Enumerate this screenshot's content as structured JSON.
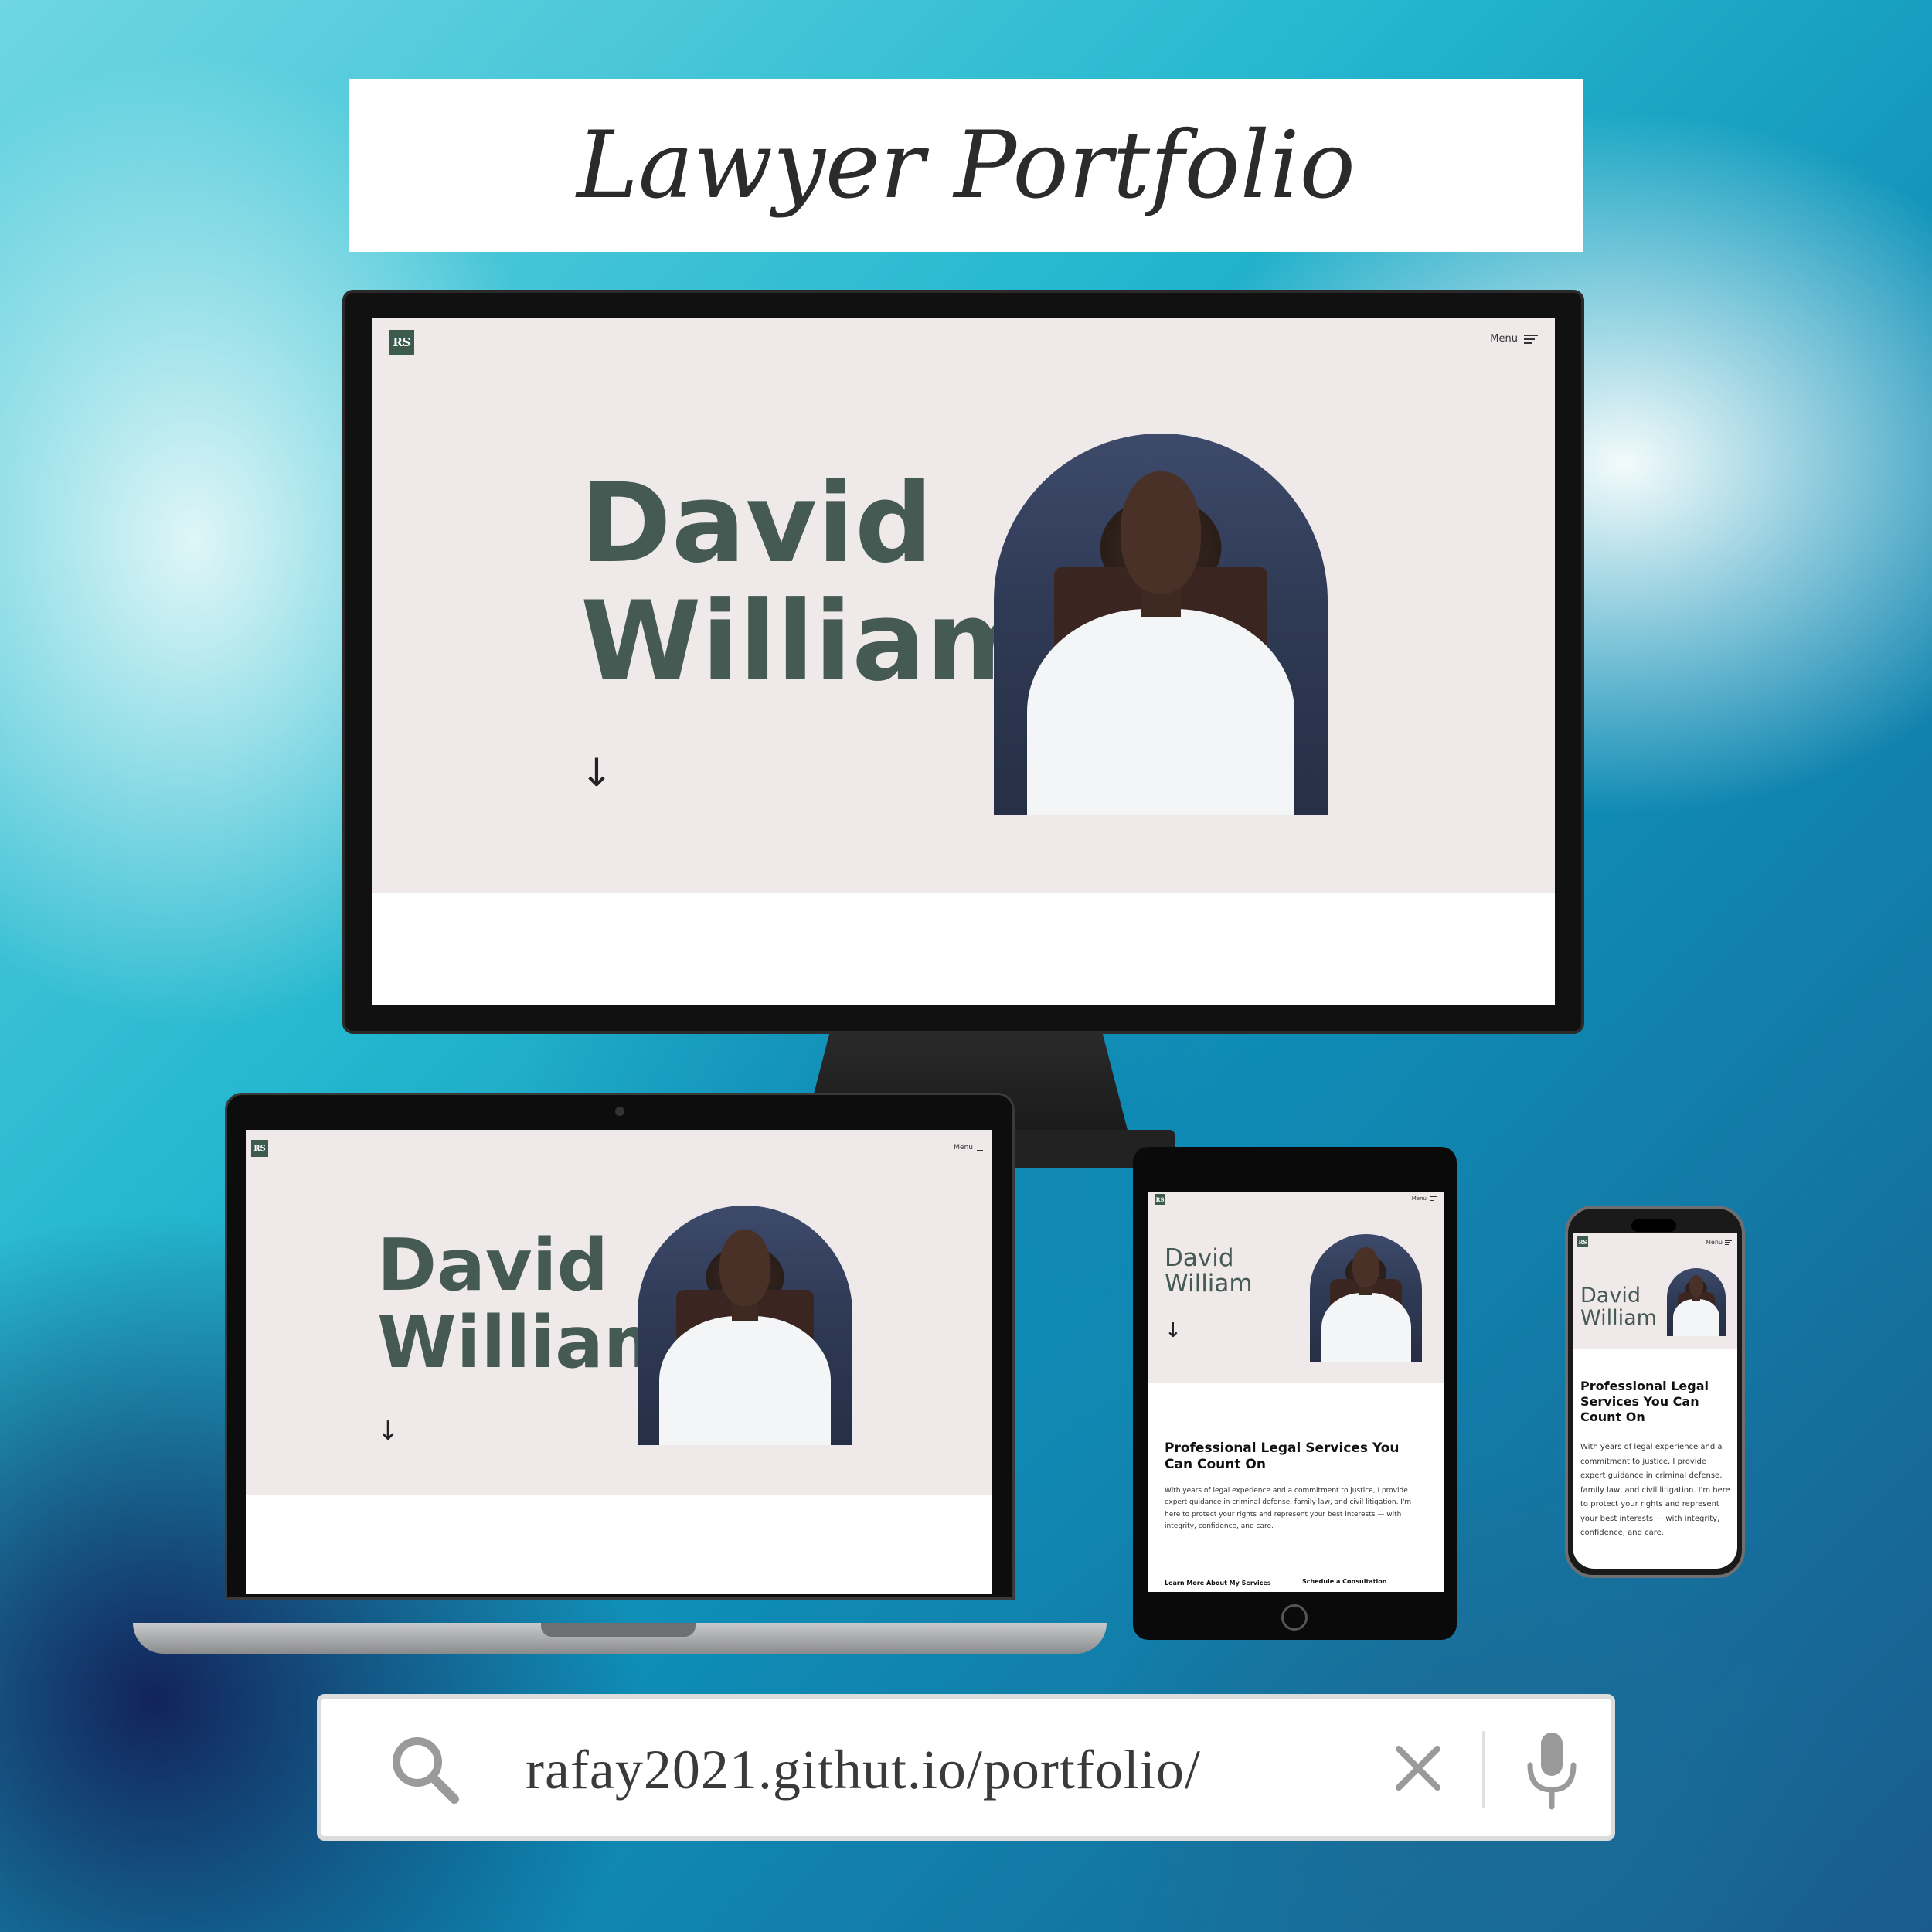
{
  "banner": {
    "title": "Lawyer Portfolio"
  },
  "site": {
    "logo": "RS",
    "menu_label": "Menu",
    "first_name": "David",
    "last_name": "William",
    "scroll_arrow": "↓",
    "section_title": "Professional Legal Services You Can Count On",
    "section_body": "With years of legal experience and a commitment to justice, I provide expert guidance in criminal defense, family law, and civil litigation. I'm here to protect your rights and represent your best interests — with integrity, confidence, and care.",
    "cta_services": "Learn More About My Services",
    "cta_consult": "Schedule a Consultation"
  },
  "search": {
    "url": "rafay2021.githut.io/portfolio/",
    "icon": "search-icon",
    "clear_icon": "close-icon",
    "mic_icon": "microphone-icon"
  },
  "colors": {
    "hero_bg": "#efe9ea",
    "name_color": "#455a52",
    "logo_bg": "#3d5a4f"
  }
}
